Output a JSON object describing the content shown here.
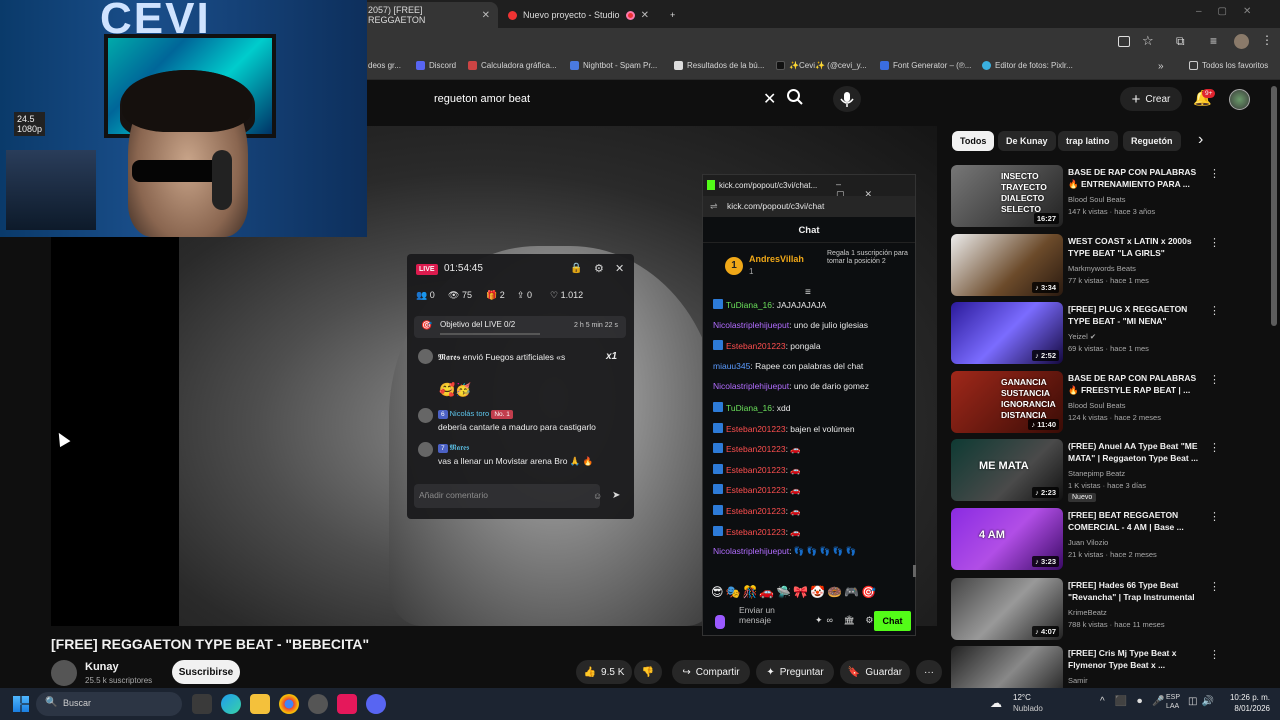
{
  "browser": {
    "tabs": [
      {
        "label": "2057) [FREE] REGGAETON",
        "active": true
      },
      {
        "label": "Nuevo proyecto - Studio",
        "active": false
      }
    ],
    "new_tab": "+",
    "bookmarks": [
      "deos gr...",
      "Discord",
      "Calculadora gráfica...",
      "Nightbot - Spam Pr...",
      "Resultados de la bú...",
      "✨Cevi✨ (@cevi_y...",
      "Font Generator – (℗...",
      "Editor de fotos: Pixlr...",
      "Todos los favoritos"
    ],
    "more_bookmarks": "»"
  },
  "youtube": {
    "search_value": "regueton amor beat",
    "create_label": "Crear",
    "notif_count": "9+",
    "video_title": "[FREE] REGGAETON TYPE BEAT - \"BEBECITA\"",
    "channel_name": "Kunay",
    "channel_subs": "25.5 k suscriptores",
    "subscribe_label": "Suscribirse",
    "likes": "9.5 K",
    "share_label": "Compartir",
    "ask_label": "Preguntar",
    "save_label": "Guardar",
    "more_label": "···",
    "chips": [
      "Todos",
      "De Kunay",
      "trap latino",
      "Reguetón"
    ],
    "chip_next": "›",
    "recommendations": [
      {
        "title": "BASE DE RAP CON PALABRAS 🔥 ENTRENAMIENTO PARA ...",
        "channel": "Blood Soul Beats",
        "meta": "147 k vistas · hace 3 años",
        "duration": "16:27",
        "thumb_text": "INSECTO TRAYECTO DIALECTO SELECTO",
        "thumb_bg": "linear-gradient(135deg,#777,#222)"
      },
      {
        "title": "WEST COAST x LATIN x 2000s TYPE BEAT \"LA GIRLS\"",
        "channel": "Markmywords Beats",
        "meta": "77 k vistas · hace 1 mes",
        "duration": "♪ 3:34",
        "thumb_text": "",
        "thumb_bg": "linear-gradient(135deg,#ececec,#6b4a2a 60%,#2a1a10)"
      },
      {
        "title": "[FREE] PLUG X REGGAETON TYPE BEAT - \"MI NENA\"",
        "channel": "Yeizel ✔",
        "meta": "69 k vistas · hace 1 mes",
        "duration": "♪ 2:52",
        "thumb_text": "",
        "thumb_bg": "linear-gradient(135deg,#2b1a9a,#7b6cff 50%,#14083f)"
      },
      {
        "title": "BASE DE RAP CON PALABRAS 🔥 FREESTYLE RAP BEAT | ...",
        "channel": "Blood Soul Beats",
        "meta": "124 k vistas · hace 2 meses",
        "duration": "♪ 11:40",
        "thumb_text": "GANANCIA SUSTANCIA IGNORANCIA DISTANCIA",
        "thumb_bg": "linear-gradient(135deg,#a0281a,#3a0c06)"
      },
      {
        "title": "(FREE) Anuel AA Type Beat \"ME MATA\" | Reggaeton Type Beat ...",
        "channel": "Stanepimp Beatz",
        "meta": "1 K vistas · hace 3 días",
        "duration": "♪ 2:23",
        "thumb_text": "ME MATA",
        "thumb_bg": "linear-gradient(135deg,#0e3a33,#4a4a4a 60%,#111)",
        "badge": "Nuevo"
      },
      {
        "title": "[FREE] BEAT REGGAETON COMERCIAL - 4 AM | Base ...",
        "channel": "Juan Vilozio",
        "meta": "21 k vistas · hace 2 meses",
        "duration": "♪ 3:23",
        "thumb_text": "4 AM",
        "thumb_bg": "linear-gradient(135deg,#8a2be2,#b14ee6 50%,#3b0a66)"
      },
      {
        "title": "[FREE] Hades 66 Type Beat \"Revancha\" | Trap Instrumental ...",
        "channel": "KrimeBeatz",
        "meta": "788 k vistas · hace 11 meses",
        "duration": "♪ 4:07",
        "thumb_text": "",
        "thumb_bg": "linear-gradient(135deg,#444,#999 50%,#222)"
      },
      {
        "title": "[FREE] Cris Mj Type Beat x Flymenor Type Beat x ...",
        "channel": "Samir",
        "meta": "",
        "duration": "",
        "thumb_text": "",
        "thumb_bg": "linear-gradient(135deg,#222,#888 50%,#111)"
      }
    ]
  },
  "webcam": {
    "logo": "CEVI",
    "fps_overlay": "24.5\n1080p"
  },
  "tiktok_live": {
    "live_badge": "LIVE",
    "timer": "01:54:45",
    "stats": {
      "users": "0",
      "views": "75",
      "gifts": "2",
      "shares": "0",
      "likes": "1.012"
    },
    "goal_label": "Objetivo del LIVE 0/2",
    "goal_time": "2 h 5 min 22 s",
    "gift_line": "𝕸𝖆𝖗𝖊𝖘 envió Fuegos artificiales «s",
    "gift_count": "x1",
    "comments": [
      {
        "user": "Nicolás toro",
        "level": "6",
        "badge": "No. 1",
        "text": "debería cantarle a maduro para castigarlo"
      },
      {
        "user": "𝕸𝖆𝖗𝖊𝖘",
        "level": "7",
        "badge": "",
        "text": "vas a llenar un Movistar arena Bro 🙏 🔥"
      }
    ],
    "input_placeholder": "Añadir comentario"
  },
  "kick": {
    "window_title": "kick.com/popout/c3vi/chat...",
    "url": "kick.com/popout/c3vi/chat",
    "chat_header": "Chat",
    "pinned_user": "AndresVillah",
    "pinned_count": "1",
    "pinned_gift": "Regala 1 suscripción para tomar la posición 2",
    "messages": [
      {
        "user": "TuDiana_16",
        "text": "JAJAJAJAJA",
        "color": "u-green"
      },
      {
        "user": "Nicolastriplehijueput",
        "text": "uno de julio iglesias",
        "color": "u-purple"
      },
      {
        "user": "Esteban201223",
        "text": "pongala",
        "color": "u-red"
      },
      {
        "user": "miauu345",
        "text": "Rapee con palabras del chat",
        "color": "u-blue"
      },
      {
        "user": "Nicolastriplehijueput",
        "text": "uno de dario gomez",
        "color": "u-purple"
      },
      {
        "user": "TuDiana_16",
        "text": "xdd",
        "color": "u-green"
      },
      {
        "user": "Esteban201223",
        "text": "bajen el volúmen",
        "color": "u-red"
      },
      {
        "user": "Esteban201223",
        "text": "🚗",
        "color": "u-red"
      },
      {
        "user": "Esteban201223",
        "text": "🚗",
        "color": "u-red"
      },
      {
        "user": "Esteban201223",
        "text": "🚗",
        "color": "u-red"
      },
      {
        "user": "Esteban201223",
        "text": "🚗",
        "color": "u-red"
      },
      {
        "user": "Esteban201223",
        "text": "🚗",
        "color": "u-red"
      },
      {
        "user": "Nicolastriplehijueput",
        "text": "👣 👣 👣 👣 👣",
        "color": "u-purple"
      }
    ],
    "send_placeholder": "Enviar un mensaje",
    "chat_button": "Chat"
  },
  "taskbar": {
    "search_placeholder": "Buscar",
    "weather_temp": "12°C",
    "weather_desc": "Nublado",
    "lang": "ESP\nLAA",
    "time": "10:26 p. m.",
    "date": "8/01/2026"
  }
}
